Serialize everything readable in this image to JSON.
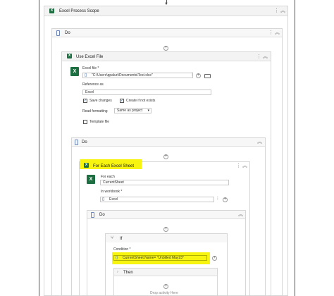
{
  "scopes": {
    "excel_process_scope": "Excel Process Scope",
    "do_outer": "Do",
    "use_excel_file": "Use Excel File",
    "do_inner": "Do",
    "for_each_sheet": "For Each Excel Sheet",
    "do_innermost": "Do",
    "if": "If",
    "then": "Then"
  },
  "use_excel_file": {
    "excel_file_label": "Excel file *",
    "excel_file_value": "\"C:\\Users\\ppaluri\\Documents\\Test.xlsx\"",
    "reference_as_label": "Reference as",
    "reference_as_value": "Excel",
    "save_changes_label": "Save changes",
    "save_changes_checked": true,
    "create_if_not_exists_label": "Create if not exists",
    "create_if_not_exists_checked": true,
    "read_formatting_label": "Read formatting",
    "read_formatting_value": "Same as project",
    "template_file_label": "Template file",
    "template_file_checked": false
  },
  "for_each": {
    "for_each_label": "For each",
    "for_each_value": "CurrentSheet",
    "in_workbook_label": "In workbook *",
    "in_workbook_value": "Excel"
  },
  "if_block": {
    "condition_label": "Condition *",
    "condition_value": "CurrentSheet.Name= \"Unbilled May23\""
  },
  "drop_hint": "Drop activity Here",
  "icons": {
    "collapse": "double-chevron-up-icon",
    "menu": "vertical-ellipsis-icon",
    "add": "plus-circle-icon",
    "excel": "excel-icon",
    "folder": "folder-icon",
    "expression": "curly-braces-icon",
    "sequence": "sequence-icon"
  },
  "colors": {
    "highlight": "#f7f50f",
    "excel_green": "#1d6f42"
  }
}
